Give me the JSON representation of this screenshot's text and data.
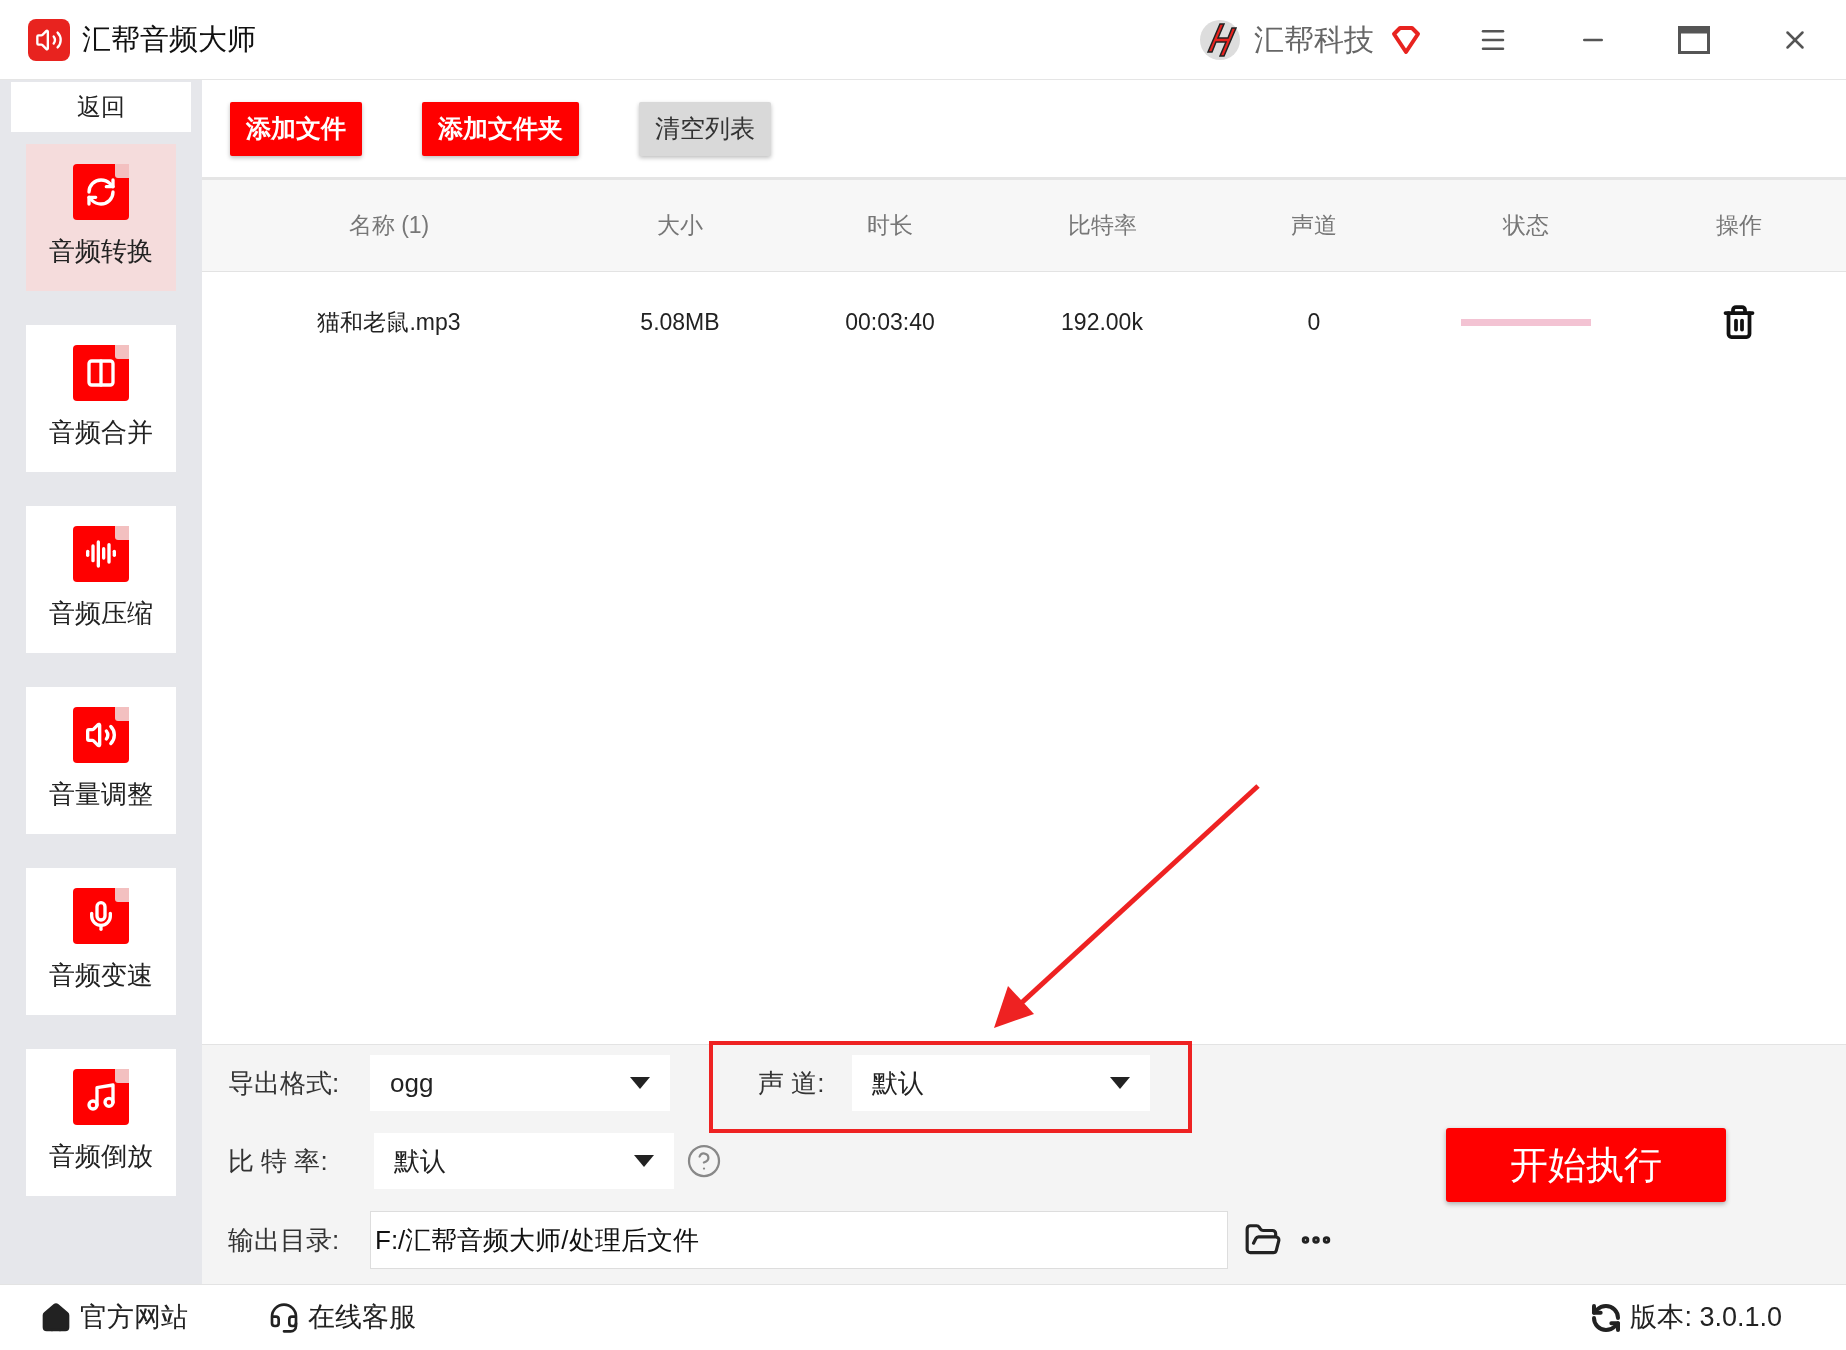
{
  "window": {
    "title": "汇帮音频大师",
    "brand": "汇帮科技"
  },
  "sidebar": {
    "back": "返回",
    "items": [
      {
        "label": "音频转换",
        "kind": "convert",
        "selected": true
      },
      {
        "label": "音频合并",
        "kind": "merge",
        "selected": false
      },
      {
        "label": "音频压缩",
        "kind": "compress",
        "selected": false
      },
      {
        "label": "音量调整",
        "kind": "volume",
        "selected": false
      },
      {
        "label": "音频变速",
        "kind": "mic",
        "selected": false
      },
      {
        "label": "音频倒放",
        "kind": "note",
        "selected": false
      }
    ]
  },
  "toolbar": [
    {
      "label": "添加文件",
      "kind": "primary"
    },
    {
      "label": "添加文件夹",
      "kind": "primary"
    },
    {
      "label": "清空列表",
      "kind": "secondary"
    }
  ],
  "table": {
    "columns": [
      "名称 (1)",
      "大小",
      "时长",
      "比特率",
      "声道",
      "状态",
      "操作"
    ],
    "rows": [
      {
        "name": "猫和老鼠.mp3",
        "size": "5.08MB",
        "duration": "00:03:40",
        "bitrate": "192.00k",
        "channels": "0"
      }
    ]
  },
  "settings": {
    "format": {
      "label": "导出格式:",
      "value": "ogg"
    },
    "channel": {
      "label": "声 道:",
      "value": "默认"
    },
    "bitrate": {
      "label": "比 特 率:",
      "value": "默认"
    },
    "output": {
      "label": "输出目录:",
      "value": "F:/汇帮音频大师/处理后文件"
    },
    "start": "开始执行"
  },
  "footer": {
    "links": [
      "官方网站",
      "在线客服"
    ],
    "version": "版本: 3.0.1.0"
  }
}
